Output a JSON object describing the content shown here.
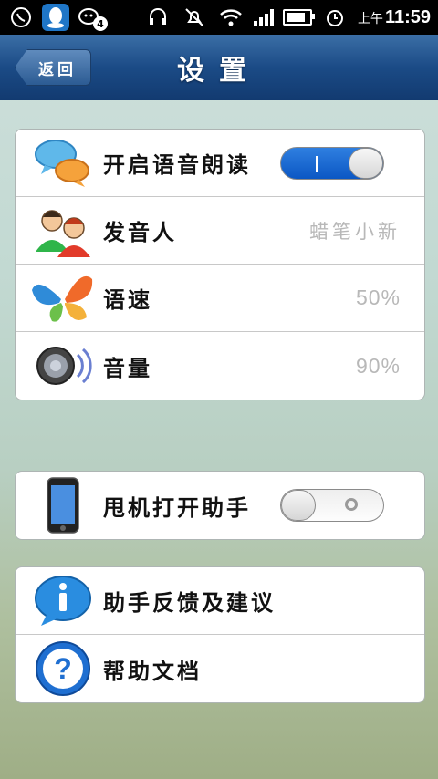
{
  "status_bar": {
    "ampm": "上午",
    "time": "11:59",
    "notification_count": "4",
    "icons": [
      "whatsapp-icon",
      "qq-icon",
      "wechat-icon",
      "headset-icon",
      "mute-icon",
      "wifi-icon",
      "signal-icon",
      "battery-icon",
      "alarm-icon"
    ]
  },
  "navbar": {
    "back_label": "返回",
    "title": "设置"
  },
  "group_voice": {
    "rows": [
      {
        "label": "开启语音朗读",
        "icon": "chat-bubbles-icon",
        "toggle": "on"
      },
      {
        "label": "发音人",
        "value": "蜡笔小新",
        "icon": "users-icon"
      },
      {
        "label": "语速",
        "value": "50%",
        "icon": "butterfly-icon"
      },
      {
        "label": "音量",
        "value": "90%",
        "icon": "speaker-icon"
      }
    ]
  },
  "group_shake": {
    "rows": [
      {
        "label": "甩机打开助手",
        "icon": "phone-icon",
        "toggle": "off"
      }
    ]
  },
  "group_help": {
    "rows": [
      {
        "label": "助手反馈及建议",
        "icon": "info-icon"
      },
      {
        "label": "帮助文档",
        "icon": "help-icon"
      }
    ]
  },
  "colors": {
    "navbar": "#1b4b86",
    "toggle_on": "#0b57c4",
    "value_text": "#b8b8b8"
  }
}
